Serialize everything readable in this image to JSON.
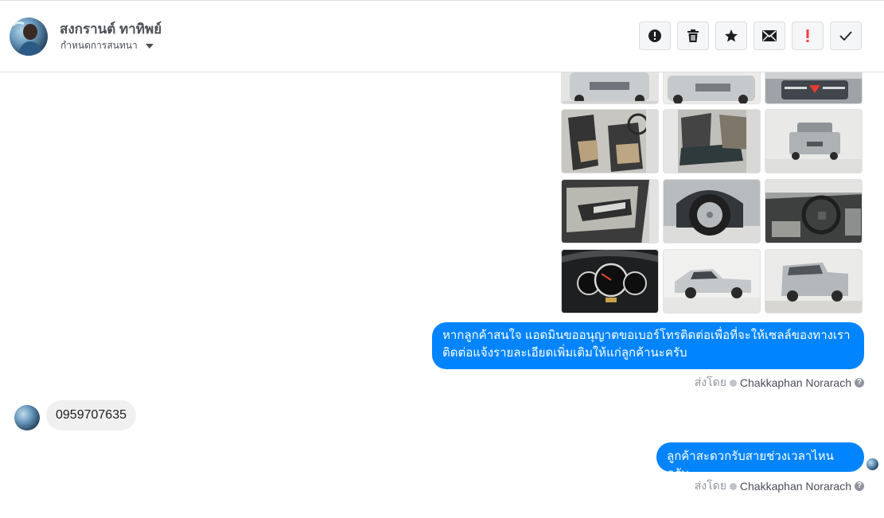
{
  "header": {
    "name": "สงกรานต์ ทาทิพย์",
    "subtitle": "กำหนดการสนทนา",
    "avatar_icon": "profile-photo"
  },
  "toolbar": {
    "buttons": [
      {
        "icon": "alert-circle-icon",
        "color": "#1c1e21"
      },
      {
        "icon": "trash-icon",
        "color": "#1c1e21"
      },
      {
        "icon": "star-icon",
        "color": "#1c1e21"
      },
      {
        "icon": "envelope-icon",
        "color": "#1c1e21"
      },
      {
        "icon": "exclamation-icon",
        "color": "#fa3e3e"
      },
      {
        "icon": "check-icon",
        "color": "#1c1e21"
      }
    ]
  },
  "photos": [
    {
      "subject": "car-front"
    },
    {
      "subject": "car-front-2"
    },
    {
      "subject": "car-grille"
    },
    {
      "subject": "seats-front"
    },
    {
      "subject": "seats-rear"
    },
    {
      "subject": "car-rear"
    },
    {
      "subject": "door-panel"
    },
    {
      "subject": "wheel"
    },
    {
      "subject": "dashboard"
    },
    {
      "subject": "gauge-cluster"
    },
    {
      "subject": "car-side"
    },
    {
      "subject": "car-rear-3q"
    }
  ],
  "messages": {
    "out1_line1": "หากลูกค้าสนใจ แอดมินขออนุญาตขอเบอร์โทรติดต่อเพื่อที่จะให้เซลล์ของทางเรา",
    "out1_line2": "ติดต่อแจ้งรายละเอียดเพิ่มเติมให้แก่ลูกค้านะครับ",
    "sent_by_label": "ส่งโดย",
    "sender": "Chakkaphan Norarach",
    "in1": "0959707635",
    "out2": "ลูกค้าสะดวกรับสายช่วงเวลาไหนครับ"
  },
  "colors": {
    "accent": "#0084ff",
    "incoming_bubble": "#f1f0f0"
  }
}
